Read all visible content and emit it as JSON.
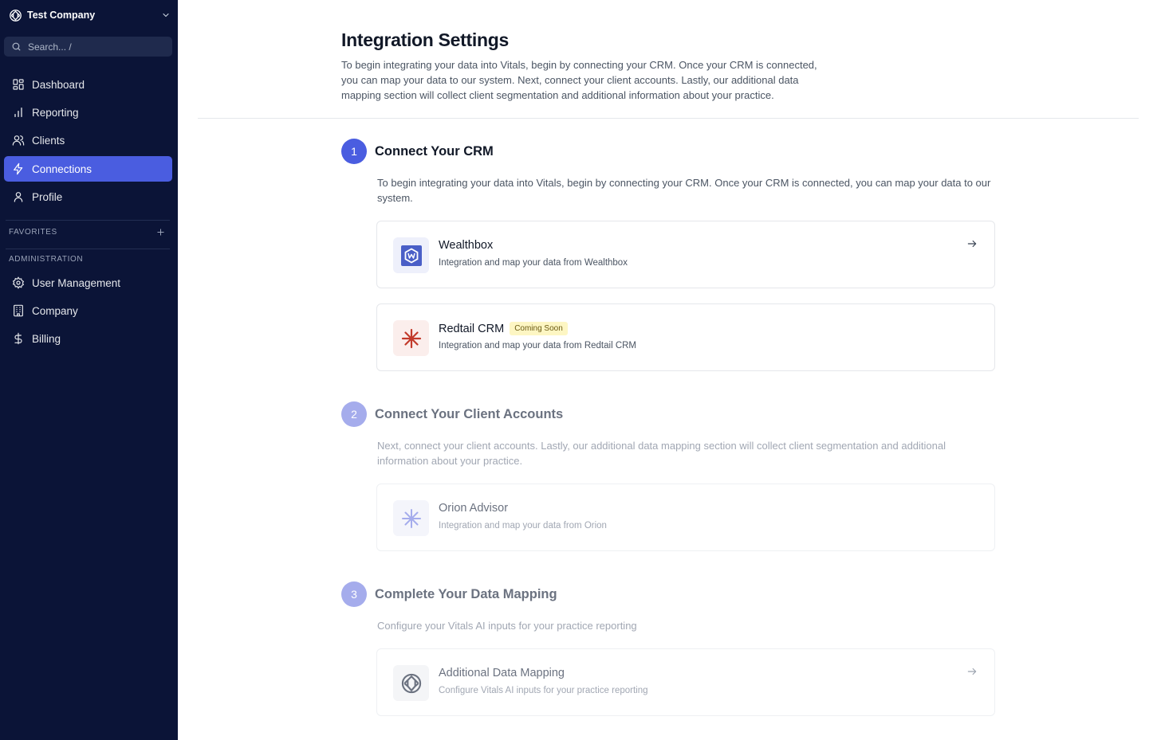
{
  "sidebar": {
    "company_name": "Test Company",
    "search_placeholder": "Search... /",
    "nav": [
      {
        "label": "Dashboard",
        "icon": "dashboard-icon"
      },
      {
        "label": "Reporting",
        "icon": "bar-chart-icon"
      },
      {
        "label": "Clients",
        "icon": "users-icon"
      },
      {
        "label": "Connections",
        "icon": "lightning-icon",
        "active": true
      },
      {
        "label": "Profile",
        "icon": "user-icon"
      }
    ],
    "favorites_label": "FAVORITES",
    "administration_label": "ADMINISTRATION",
    "admin_nav": [
      {
        "label": "User Management",
        "icon": "gear-icon"
      },
      {
        "label": "Company",
        "icon": "building-icon"
      },
      {
        "label": "Billing",
        "icon": "dollar-icon"
      }
    ]
  },
  "main": {
    "title": "Integration Settings",
    "description": "To begin integrating your data into Vitals, begin by connecting your CRM. Once your CRM is connected, you can map your data to our system. Next, connect your client accounts. Lastly, our additional data mapping section will collect client segmentation and additional information about your practice.",
    "steps": [
      {
        "number": "1",
        "title": "Connect Your CRM",
        "description": "To begin integrating your data into Vitals, begin by connecting your CRM. Once your CRM is connected, you can map your data to our system.",
        "cards": [
          {
            "title": "Wealthbox",
            "subtitle": "Integration and map your data from Wealthbox",
            "icon": "wealthbox-logo-icon"
          },
          {
            "title": "Redtail CRM",
            "badge": "Coming Soon",
            "subtitle": "Integration and map your data from Redtail CRM",
            "icon": "redtail-logo-icon"
          }
        ]
      },
      {
        "number": "2",
        "title": "Connect Your Client Accounts",
        "description": "Next, connect your client accounts. Lastly, our additional data mapping section will collect client segmentation and additional information about your practice.",
        "cards": [
          {
            "title": "Orion Advisor",
            "subtitle": "Integration and map your data from Orion",
            "icon": "orion-logo-icon"
          }
        ]
      },
      {
        "number": "3",
        "title": "Complete Your Data Mapping",
        "description": "Configure your Vitals AI inputs for your practice reporting",
        "cards": [
          {
            "title": "Additional Data Mapping",
            "subtitle": "Configure Vitals AI inputs for your practice reporting",
            "icon": "vitals-logo-icon"
          }
        ]
      }
    ]
  },
  "colors": {
    "sidebar_bg": "#0b1437",
    "accent": "#4a5de0",
    "accent_muted": "#a5acec",
    "badge_bg": "#fdf6c3"
  }
}
